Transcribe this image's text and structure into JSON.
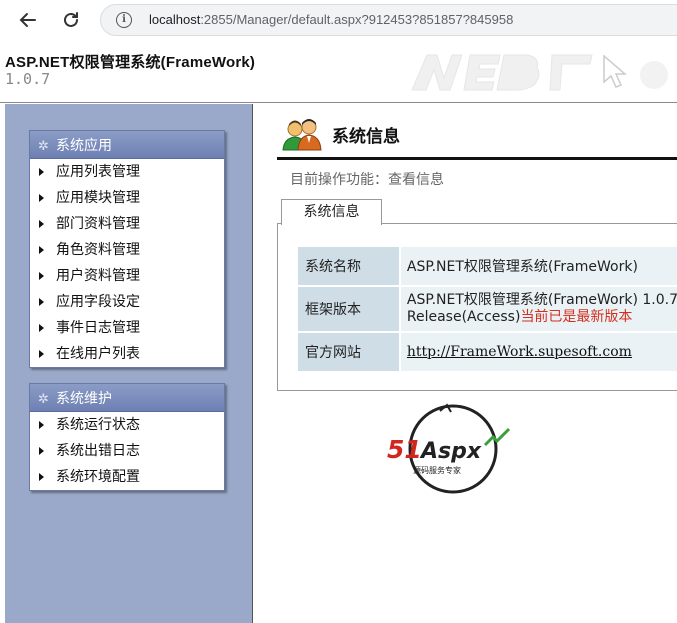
{
  "browser": {
    "url_host": "localhost",
    "url_rest": ":2855/Manager/default.aspx?912453?851857?845958"
  },
  "app": {
    "title": "ASP.NET权限管理系统(FrameWork)",
    "version": "1.0.7"
  },
  "sidebar": {
    "groups": [
      {
        "title": "系统应用",
        "items": [
          "应用列表管理",
          "应用模块管理",
          "部门资料管理",
          "角色资料管理",
          "用户资料管理",
          "应用字段设定",
          "事件日志管理",
          "在线用户列表"
        ]
      },
      {
        "title": "系统维护",
        "items": [
          "系统运行状态",
          "系统出错日志",
          "系统环境配置"
        ]
      }
    ]
  },
  "main": {
    "title": "系统信息",
    "current_op": "目前操作功能：查看信息",
    "tab_label": "系统信息",
    "rows": [
      {
        "key": "系统名称",
        "value": "ASP.NET权限管理系统(FrameWork)"
      },
      {
        "key": "框架版本",
        "value_line1": "ASP.NET权限管理系统(FrameWork) 1.0.7",
        "value_line2_prefix": "Release(Access)",
        "value_line2_status": "当前已是最新版本"
      },
      {
        "key": "官方网站",
        "value": "http://FrameWork.supesoft.com"
      }
    ]
  },
  "logo": {
    "brand": "51Aspx",
    "tagline": "源码服务专家"
  },
  "colors": {
    "sidebar_bg": "#9aa9c9",
    "menu_header": "#7a8cbd",
    "table_key_bg": "#cfdde6",
    "table_val_bg": "#eaf2f6",
    "status_red": "#d32f1f"
  }
}
